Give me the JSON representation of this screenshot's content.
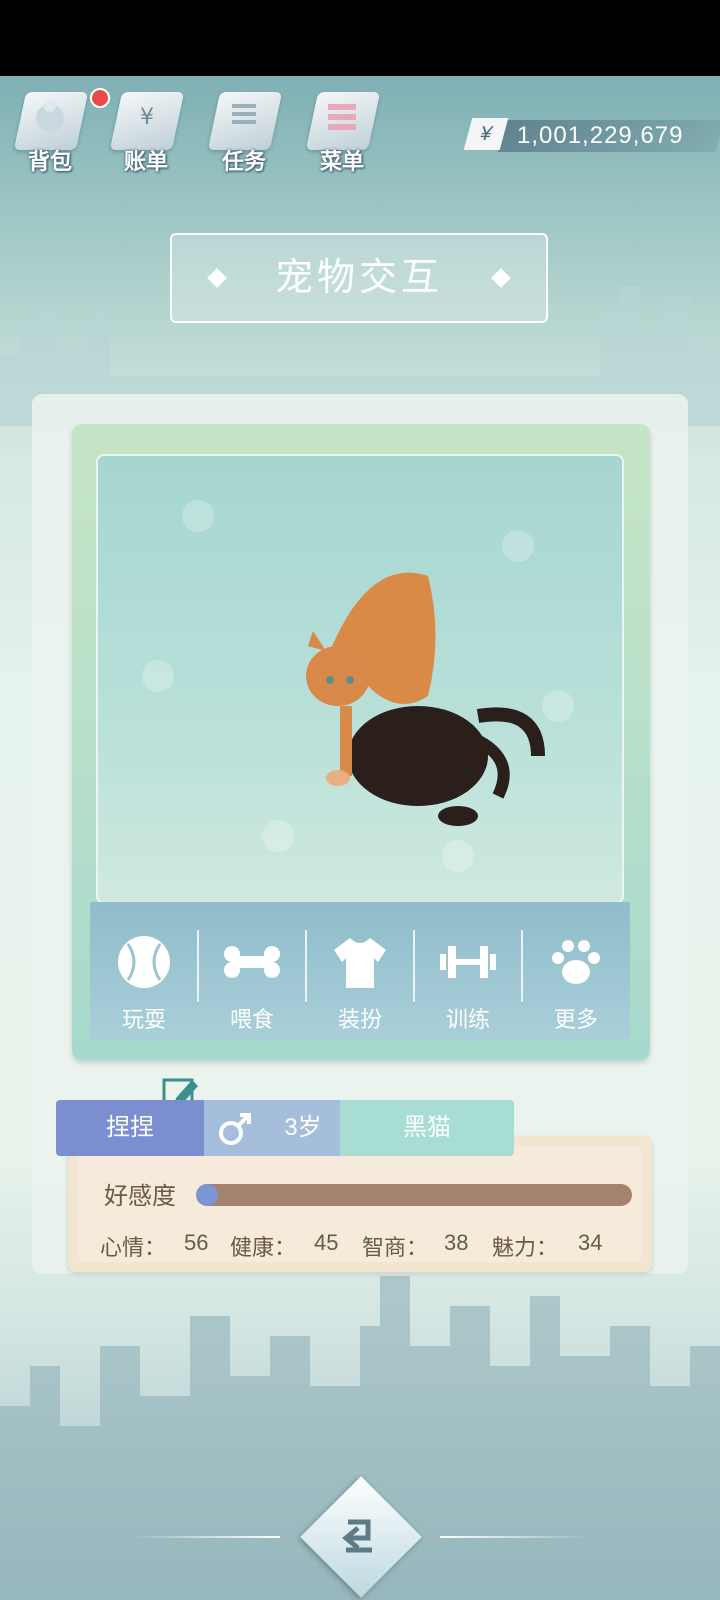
{
  "topbar": {
    "items": [
      {
        "label": "背包",
        "icon": "backpack-icon",
        "badge": true
      },
      {
        "label": "账单",
        "icon": "bill-icon"
      },
      {
        "label": "任务",
        "icon": "task-icon"
      },
      {
        "label": "菜单",
        "icon": "menu-icon"
      }
    ],
    "currency_symbol": "¥",
    "balance": "1,001,229,679"
  },
  "title": "宠物交互",
  "actions": [
    {
      "label": "玩耍",
      "icon": "ball-icon"
    },
    {
      "label": "喂食",
      "icon": "bone-icon"
    },
    {
      "label": "装扮",
      "icon": "shirt-icon"
    },
    {
      "label": "训练",
      "icon": "dumbbell-icon"
    },
    {
      "label": "更多",
      "icon": "paw-icon"
    }
  ],
  "pet": {
    "name": "捏捏",
    "gender_symbol": "♂",
    "age": "3岁",
    "breed": "黑猫"
  },
  "stats": {
    "favor_label": "好感度",
    "favor_progress": 0.05,
    "mood_label": "心情：",
    "mood": "56",
    "health_label": "健康：",
    "health": "45",
    "iq_label": "智商：",
    "iq": "38",
    "charm_label": "魅力：",
    "charm": "34"
  },
  "colors": {
    "accent_blue": "#7b8fd0",
    "favor_track": "#a3836e",
    "badge_red": "#ea4a4a"
  }
}
